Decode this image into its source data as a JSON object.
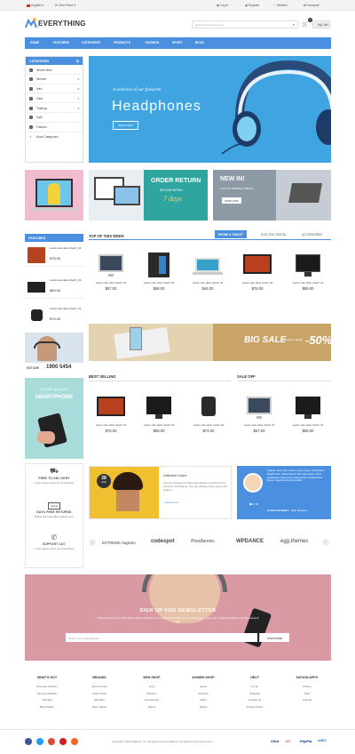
{
  "topbar": {
    "language": "English",
    "currency": "Hi-Tech Store",
    "login": "Log in",
    "register": "Register",
    "wishlist": "Wishlist",
    "compare": "Compare"
  },
  "header": {
    "logo_text": "EVERYTHING",
    "search_placeholder": "Search entire store here...",
    "cart_label": "My Cart",
    "cart_count": "0"
  },
  "nav": [
    "HOME",
    "FEATURES",
    "CATEGORYS",
    "PRODUCTS",
    "FASHION",
    "SPORT",
    "BLOG"
  ],
  "categories": {
    "title": "CATEGORIES",
    "items": [
      {
        "label": "What's New",
        "arrow": ""
      },
      {
        "label": "Women",
        "arrow": "▾"
      },
      {
        "label": "Men",
        "arrow": "▾"
      },
      {
        "label": "Gear",
        "arrow": "▾"
      },
      {
        "label": "Training",
        "arrow": "▾"
      },
      {
        "label": "Sale",
        "arrow": ""
      },
      {
        "label": "Fashion",
        "arrow": ""
      },
      {
        "label": "More Categories",
        "arrow": ""
      }
    ]
  },
  "hero": {
    "subtitle": "A selection of our favourite",
    "title": "Headphones",
    "button": "SHOP NOW"
  },
  "banners": {
    "order_title": "ORDER RETURN",
    "order_sub": "RETURN WITHIN",
    "order_days": "7 days",
    "new_title": "NEW IN!",
    "new_sub": "LAPTOP, MOBILE, TABLET...",
    "new_btn": "SHOP NOW"
  },
  "featured": {
    "title": "FEATURED",
    "items": [
      {
        "name": "Lacks side table hitach_04",
        "price": "$76.00"
      },
      {
        "name": "Lacks side table hitach_04",
        "price": "$89.00"
      },
      {
        "name": "Lacks side table hitach_04",
        "price": "$74.00"
      }
    ]
  },
  "top_week": {
    "title": "TOP OF THIS WEEK",
    "tabs": [
      "PHONE & TABLET",
      "ELECTRIC DIGITAL",
      "ACCESSORIES"
    ],
    "products": [
      {
        "name": "Lacks side table hitach 01",
        "price": "$57.00"
      },
      {
        "name": "Lacks side table hitach 02",
        "price": "$58.00"
      },
      {
        "name": "Lacks side table hitach 02",
        "price": "$46.00"
      },
      {
        "name": "Lacks side table hitach 02",
        "price": "$76.00"
      },
      {
        "name": "Lacks side table hitach 02",
        "price": "$89.00"
      }
    ]
  },
  "hotline": {
    "label": "HOTLINE",
    "number": "1900 5454"
  },
  "big_sale": {
    "title": "BIG SALE",
    "sub": "Electronic digital",
    "percent": "-50%"
  },
  "smartphone_promo": {
    "line1": "Get 50% off on new",
    "line2": "SMARTPHONE"
  },
  "best_selling": {
    "title": "BEST SELLING",
    "products": [
      {
        "name": "Lacks side table hitach 04",
        "price": "$76.00"
      },
      {
        "name": "Lacks side table hitach 04",
        "price": "$58.00"
      },
      {
        "name": "Lacks side table hitach 04",
        "price": "$74.00"
      }
    ]
  },
  "sale_off": {
    "title": "SALE OFF",
    "products": [
      {
        "name": "Lacks side table hitach 04",
        "price": "$57.00"
      },
      {
        "name": "Lacks side table hitach 01",
        "price": "$58.00"
      }
    ]
  },
  "services": [
    {
      "title": "FREE TO DELIVERY",
      "sub": "Lorem ipsum dolor sit consectetur"
    },
    {
      "title": "DAYS FREE RETURNS",
      "sub": "Maecenas imperdiet sagittis enim"
    },
    {
      "title": "SUPPORT 24/7",
      "sub": "Lorem ipsum dolor sit consectetur"
    }
  ],
  "blog": {
    "day": "28",
    "month": "AUG",
    "title": "Unlimited Colors",
    "text": "You can change the visual appearance of almost every element of the theme. You can change colors using color pickers...",
    "link": "» Read more"
  },
  "testimonial": {
    "quote": "Aliquam quis risus viverra ornare neque. Vestibulum blandit nunc. Nulla ultrices nibh vitae turpis. Nunc scelerisque vitae neque ullamcorper condimentum. Donec mauris luctus erat mollis.",
    "name": "CLEHA GILBERT",
    "role": "- Web designer"
  },
  "brands": [
    "EXTREME magento",
    "codespot",
    "Prestherres",
    "WPDANCE",
    "egg.themes"
  ],
  "newsletter": {
    "title": "SIGN UP FOR NEWSLETTER",
    "text": "Aliquam ante arcu in with dictum aliquet. Aliquam non condimentum nulla. Integer scelerisque, augue sem congue imperdiet, a luctus euismod diam.",
    "placeholder": "Enter your email address",
    "button": "SUBSCRIBE"
  },
  "footer": {
    "columns": [
      {
        "title": "WHAT'S HOT",
        "links": [
          "Discount Voucher",
          "Spring Collection",
          "Trending",
          "Best Sellers"
        ]
      },
      {
        "title": "BRANDS",
        "links": [
          "Jack & Jones",
          "Calvin Klein",
          "Ray Ban",
          "River Island"
        ]
      },
      {
        "title": "MEN SHOP",
        "links": [
          "Toys",
          "Bottoms",
          "Accessories",
          "Shoes"
        ]
      },
      {
        "title": "WOMEN SHOP",
        "links": [
          "Jeans",
          "Dresses",
          "Other",
          "Shoes"
        ]
      },
      {
        "title": "HELP",
        "links": [
          "F.A.Q.",
          "Shipping",
          "Contact Us",
          "Privacy Policy"
        ]
      },
      {
        "title": "NATION APPS",
        "links": [
          "iPhone",
          "iPad",
          "Android"
        ]
      }
    ],
    "copyright": "Copyright © 2017 Magento, Inc. All rights reserved. Magento Templates by EmThemes.com",
    "payments": [
      "VISA",
      "MC",
      "PayPal",
      "AMEX"
    ]
  }
}
